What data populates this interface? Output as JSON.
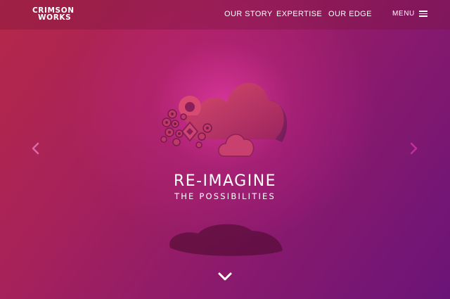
{
  "brand": {
    "line1": "CRIMSON",
    "line2": "WORKS"
  },
  "nav": {
    "items": [
      "OUR STORY",
      "EXPERTISE",
      "OUR EDGE"
    ],
    "menu_label": "MENU"
  },
  "hero": {
    "title": "RE-IMAGINE",
    "subtitle": "THE POSSIBILITIES"
  },
  "icons": {
    "prev": "chevron-left-icon",
    "next": "chevron-right-icon",
    "scroll": "chevron-down-icon",
    "menu": "hamburger-icon",
    "hero": "cloud-location-icon"
  },
  "colors": {
    "background_left": "#b42848",
    "background_right": "#6a1478",
    "arrow_pink": "#d96aa8",
    "arrow_magenta": "#c0309a",
    "text": "#ffffff"
  }
}
